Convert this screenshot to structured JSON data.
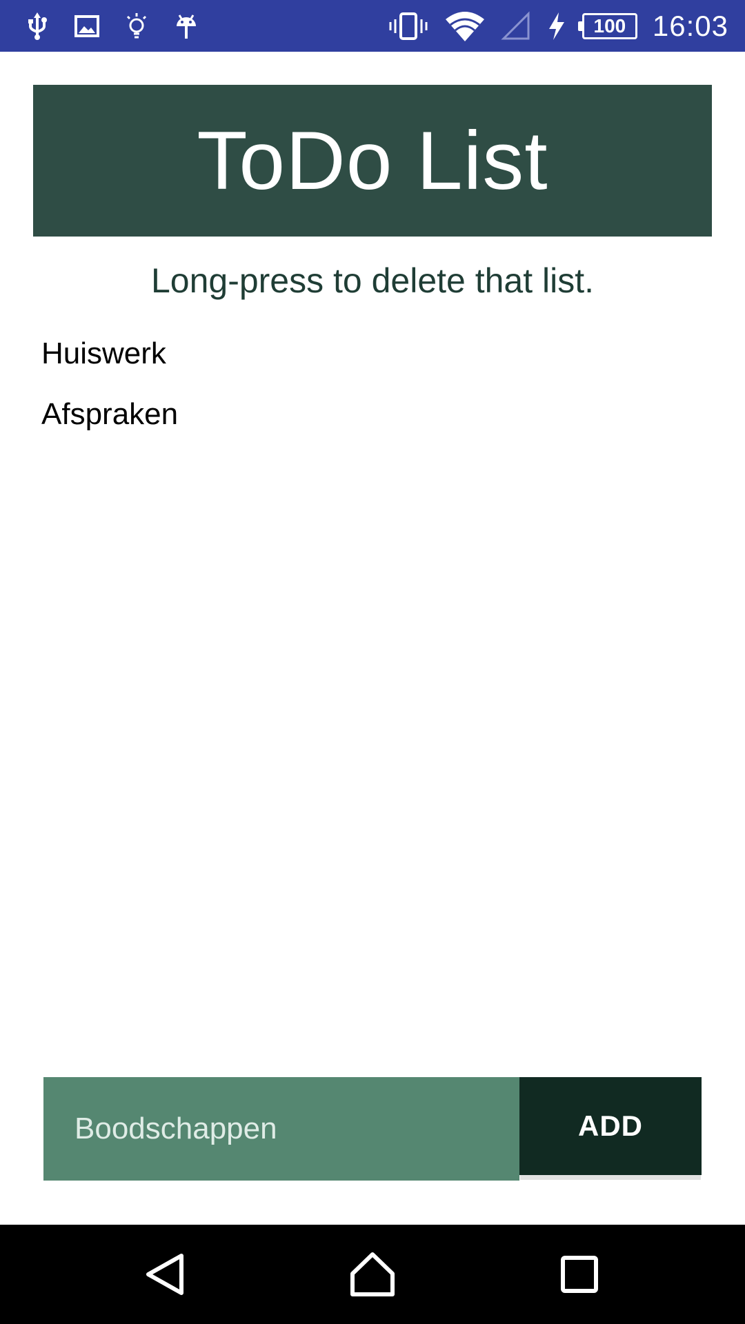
{
  "status_bar": {
    "left_icons": [
      "usb-icon",
      "image-icon",
      "lightbulb-icon",
      "android-icon"
    ],
    "right_icons": [
      "vibrate-icon",
      "wifi-icon",
      "signal-icon",
      "charging-icon"
    ],
    "battery_level": "100",
    "time": "16:03",
    "color": "#303F9F"
  },
  "header": {
    "title": "ToDo List",
    "color": "#2F4D45"
  },
  "hint": "Long-press to delete that list.",
  "lists": [
    {
      "label": "Huiswerk"
    },
    {
      "label": "Afspraken"
    }
  ],
  "input": {
    "value": "",
    "placeholder": "Boodschappen",
    "color": "#558771"
  },
  "add_button": {
    "label": "ADD",
    "color": "#112A22"
  },
  "nav_bar": {
    "buttons": [
      "back-icon",
      "home-icon",
      "recents-icon"
    ]
  }
}
